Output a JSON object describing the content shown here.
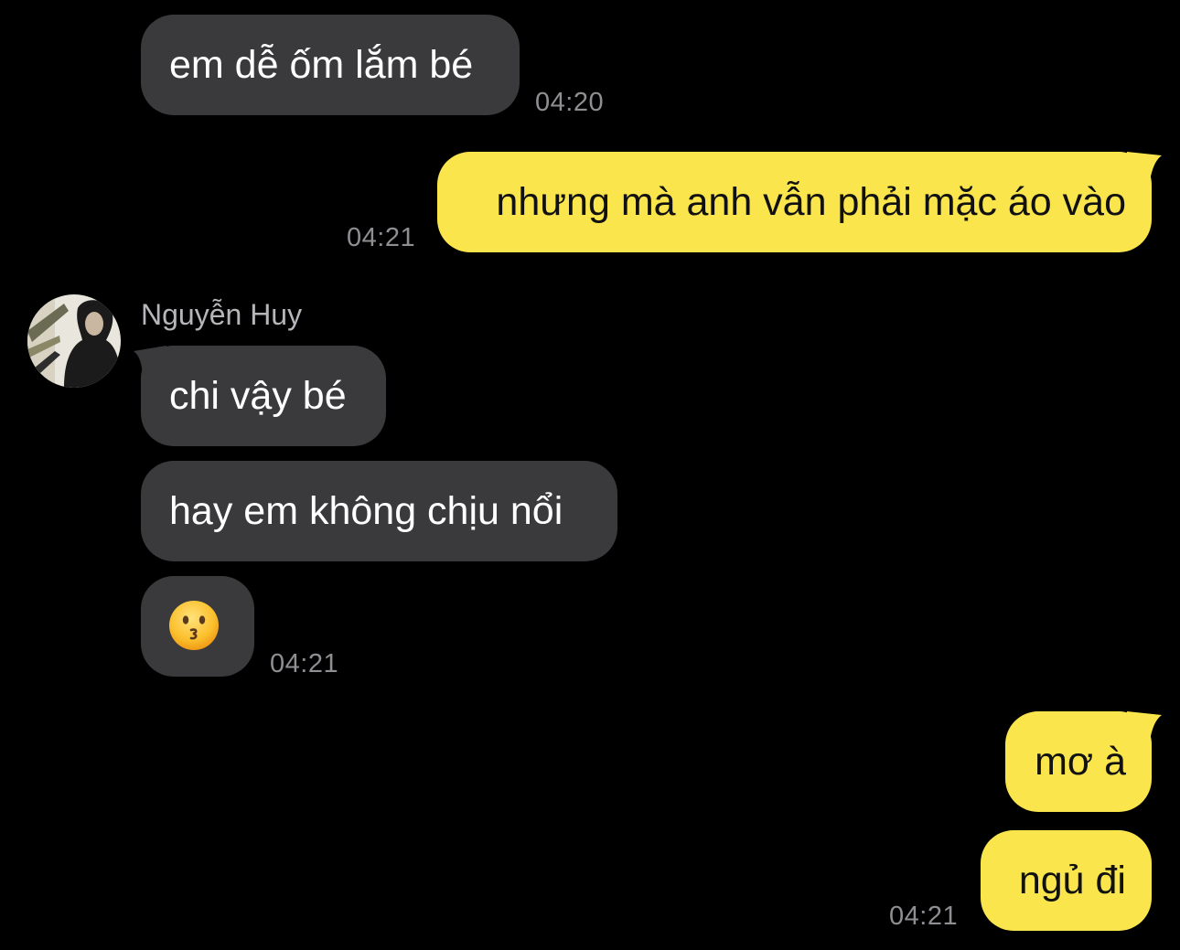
{
  "conversation": {
    "sender_name": "Nguyễn Huy",
    "messages": [
      {
        "direction": "incoming",
        "text": "em dễ ốm lắm bé",
        "time": "04:20"
      },
      {
        "direction": "outgoing",
        "text": "nhưng mà anh vẫn phải mặc áo vào",
        "time": "04:21"
      },
      {
        "direction": "incoming",
        "text": "chi vậy bé"
      },
      {
        "direction": "incoming",
        "text": "hay em không chịu nổi"
      },
      {
        "direction": "incoming",
        "emoji": "kissing-face",
        "time": "04:21"
      },
      {
        "direction": "outgoing",
        "text": "mơ à"
      },
      {
        "direction": "outgoing",
        "text": "ngủ đi",
        "time": "04:21"
      }
    ]
  },
  "colors": {
    "background": "#000000",
    "incoming_bubble": "#3a3a3c",
    "outgoing_bubble": "#fae64c",
    "timestamp": "#8e8e93"
  }
}
